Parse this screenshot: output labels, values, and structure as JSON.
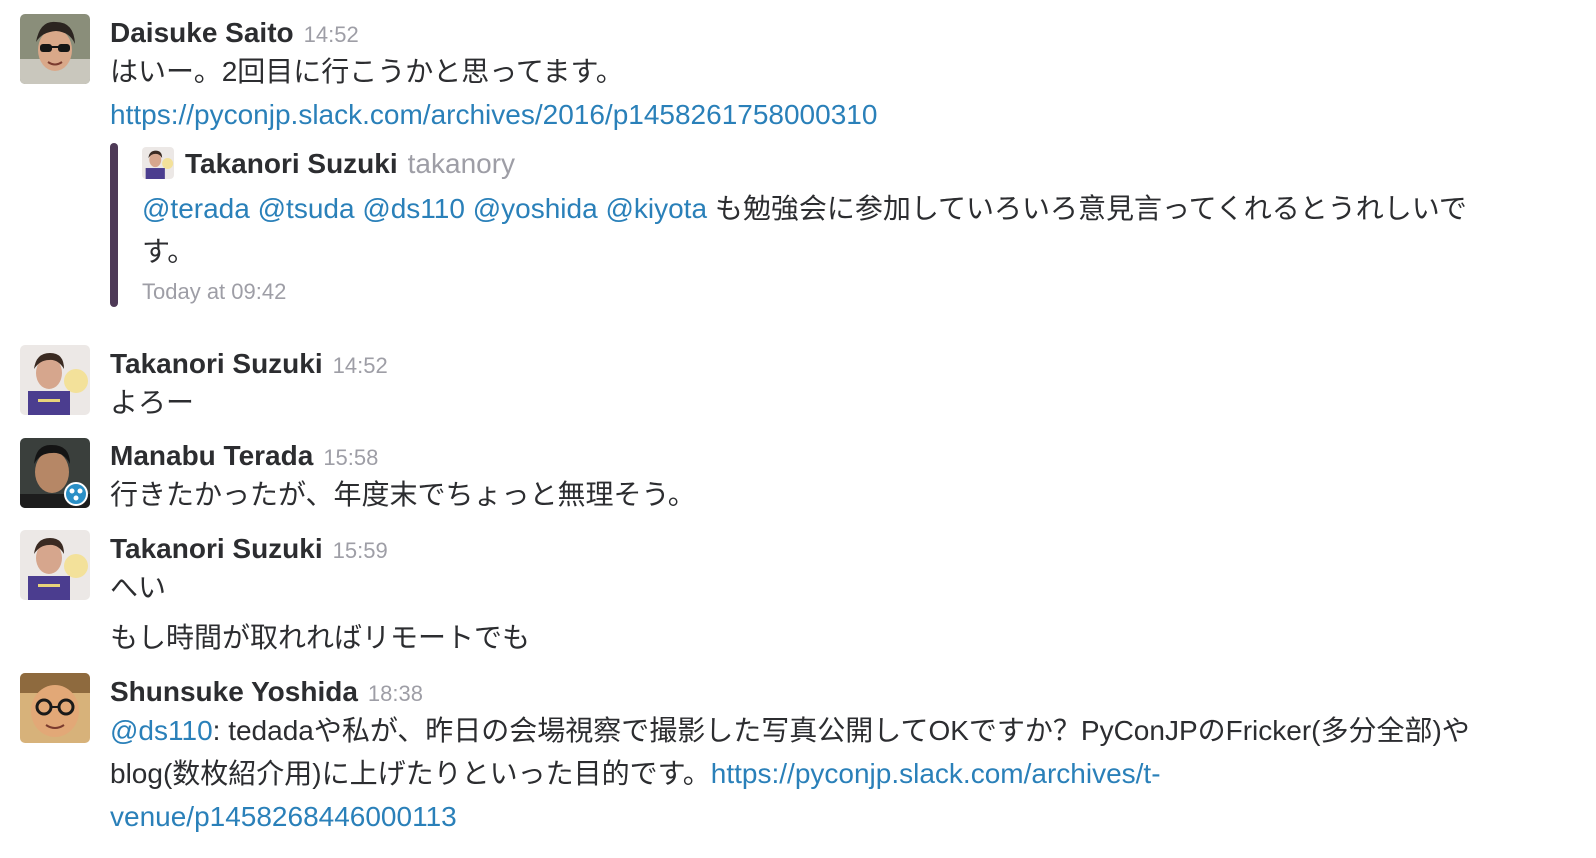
{
  "messages": [
    {
      "author": "Daisuke Saito",
      "time": "14:52",
      "text": "はいー。2回目に行こうかと思ってます。",
      "link": "https://pyconjp.slack.com/archives/2016/p1458261758000310",
      "quote": {
        "author": "Takanori Suzuki",
        "handle": "takanory",
        "mentions": [
          "@terada",
          "@tsuda",
          "@ds110",
          "@yoshida",
          "@kiyota"
        ],
        "text_line1": "も勉強会に参加していろいろ意見言ってくれるとうれしいで",
        "text_line2": "す。",
        "time": "Today at 09:42"
      }
    },
    {
      "author": "Takanori Suzuki",
      "time": "14:52",
      "text": "よろー"
    },
    {
      "author": "Manabu Terada",
      "time": "15:58",
      "text": "行きたかったが、年度末でちょっと無理そう。"
    },
    {
      "author": "Takanori Suzuki",
      "time": "15:59",
      "text": "へい",
      "text2": "もし時間が取れればリモートでも"
    },
    {
      "author": "Shunsuke Yoshida",
      "time": "18:38",
      "mention": "@ds110",
      "text_line1": ": tedadaや私が、昨日の会場視察で撮影した写真公開してOKですか？PyConJPのFricker(多分全部)や",
      "text_line2": "blog(数枚紹介用)に上げたりといった目的です。",
      "link_part1": "https://pyconjp.slack.com/archives/t-",
      "link_part2": "venue/p1458268446000113"
    }
  ],
  "colors": {
    "link": "#2a80b9",
    "muted": "#9e9ea6",
    "text": "#2c2d30",
    "quote_bar": "#4e3a57"
  }
}
